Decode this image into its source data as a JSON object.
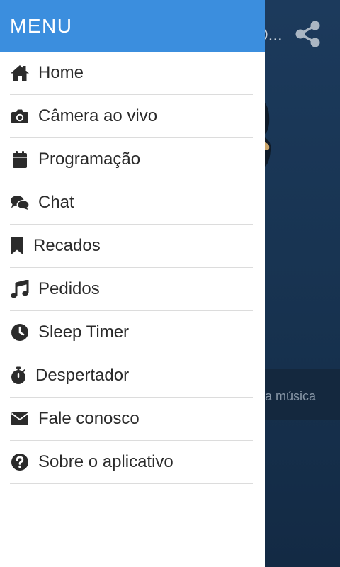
{
  "background": {
    "title": "O...",
    "bar_text": "a música",
    "share_icon": "share-icon"
  },
  "drawer": {
    "title": "MENU",
    "items": [
      {
        "label": "Home",
        "icon": "home-icon"
      },
      {
        "label": "Câmera ao vivo",
        "icon": "camera-icon"
      },
      {
        "label": "Programação",
        "icon": "calendar-icon"
      },
      {
        "label": "Chat",
        "icon": "chat-icon"
      },
      {
        "label": "Recados",
        "icon": "bookmark-icon"
      },
      {
        "label": "Pedidos",
        "icon": "music-icon"
      },
      {
        "label": "Sleep Timer",
        "icon": "clock-icon"
      },
      {
        "label": "Despertador",
        "icon": "stopwatch-icon"
      },
      {
        "label": "Fale conosco",
        "icon": "envelope-icon"
      },
      {
        "label": "Sobre o aplicativo",
        "icon": "question-circle-icon"
      }
    ]
  },
  "colors": {
    "header": "#3b8ede",
    "icon": "#2b2b2b",
    "divider": "#dcdcdc"
  }
}
